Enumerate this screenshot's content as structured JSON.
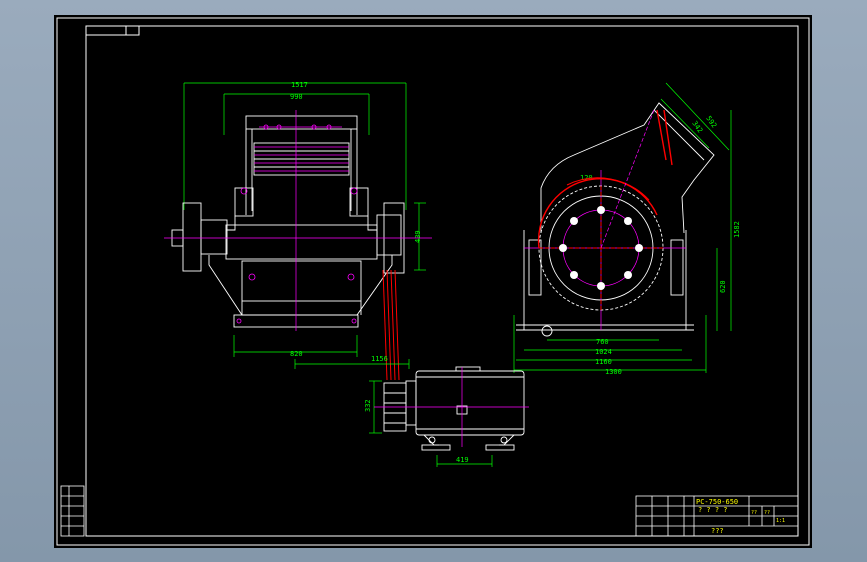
{
  "drawing": {
    "colors": {
      "background": "#000000",
      "frame": "#ffffff",
      "dimension": "#00ff00",
      "part": "#ffffff",
      "center": "#ff00ff",
      "highlight": "#ff0000",
      "text": "#ffff00"
    },
    "front_view": {
      "dims": {
        "overall_width": "1517",
        "inner_width": "990",
        "base_width": "820",
        "side_height": "439"
      }
    },
    "side_view": {
      "dims": {
        "inlet_outer": "592",
        "inlet_inner": "342",
        "angle": "120",
        "height_total": "1582",
        "height_lower": "620",
        "base_inner": "760",
        "base_mid": "1024",
        "base_outer": "1160",
        "base_total": "1300"
      }
    },
    "motor_view": {
      "dims": {
        "offset": "1156",
        "pulley_height": "332",
        "foot_spacing": "419"
      }
    },
    "title_block": {
      "drawing_no": "PC-750-650",
      "part_name": "? ? ? ?",
      "company": "???",
      "small_labels": [
        "??",
        "??",
        "1:1"
      ]
    }
  }
}
